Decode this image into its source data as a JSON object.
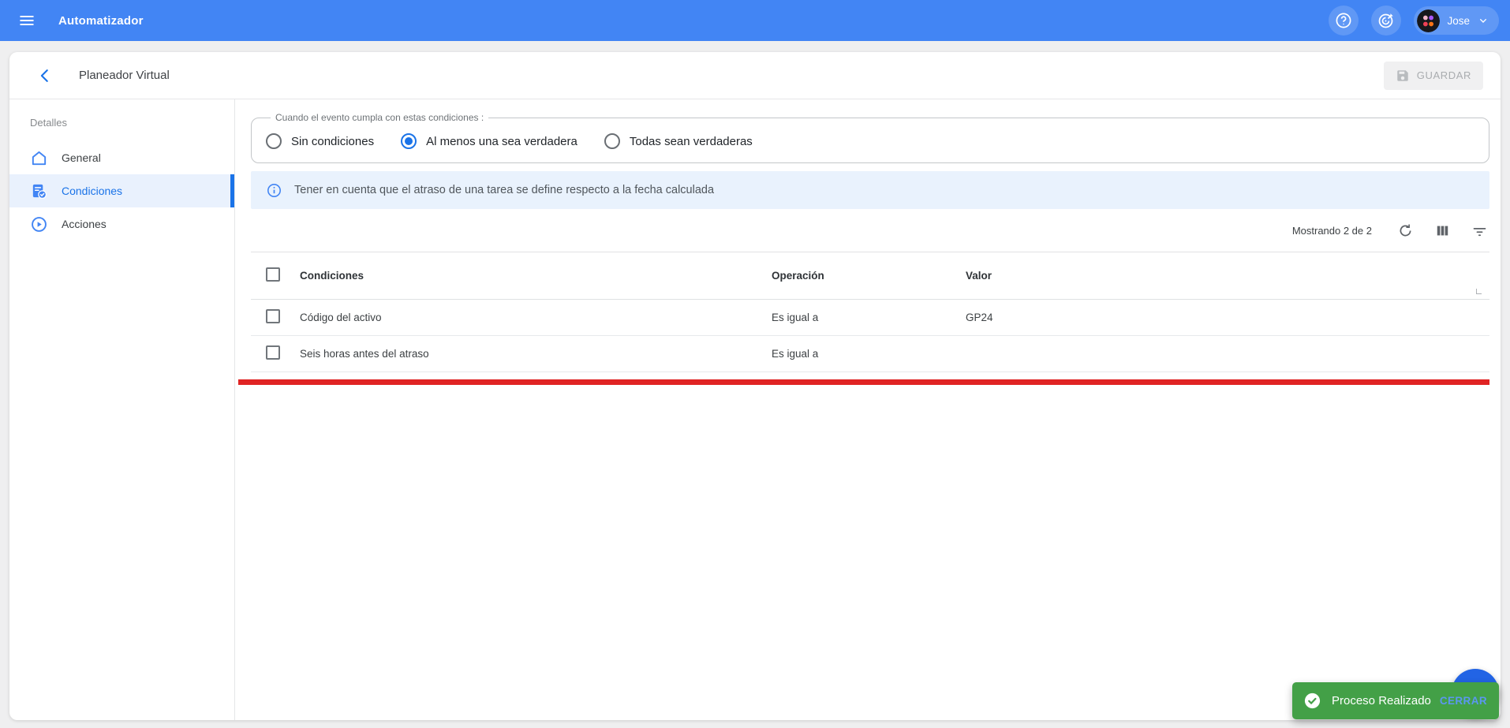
{
  "app_bar": {
    "title": "Automatizador",
    "user_name": "Jose"
  },
  "page_header": {
    "title": "Planeador Virtual",
    "save_label": "GUARDAR"
  },
  "sidebar": {
    "section_label": "Detalles",
    "items": [
      {
        "label": "General",
        "icon": "home-icon",
        "selected": false
      },
      {
        "label": "Condiciones",
        "icon": "fact-check-icon",
        "selected": true
      },
      {
        "label": "Acciones",
        "icon": "play-circle-icon",
        "selected": false
      }
    ]
  },
  "conditions_panel": {
    "legend": "Cuando el evento cumpla con estas condiciones :",
    "options": [
      {
        "label": "Sin condiciones",
        "selected": false
      },
      {
        "label": "Al menos una sea verdadera",
        "selected": true
      },
      {
        "label": "Todas sean verdaderas",
        "selected": false
      }
    ],
    "info_banner": "Tener en cuenta que el atraso de una tarea se define respecto a la fecha calculada"
  },
  "table": {
    "showing_text": "Mostrando 2 de 2",
    "columns": [
      "Condiciones",
      "Operación",
      "Valor"
    ],
    "header_checked": false,
    "rows": [
      {
        "condicion": "Código del activo",
        "operacion": "Es igual a",
        "valor": "GP24",
        "checked": false
      },
      {
        "condicion": "Seis horas antes del atraso",
        "operacion": "Es igual a",
        "valor": "",
        "checked": false
      }
    ]
  },
  "toast": {
    "message": "Proceso Realizado",
    "action_label": "CERRAR"
  },
  "colors": {
    "app_bar": "#4285f4",
    "accent": "#1a73e8",
    "selected_bg": "#e9f1fd",
    "banner_bg": "#e9f2fd",
    "alert_red": "#e02424",
    "toast_green": "#43a047",
    "fab_blue": "#2264e5"
  }
}
